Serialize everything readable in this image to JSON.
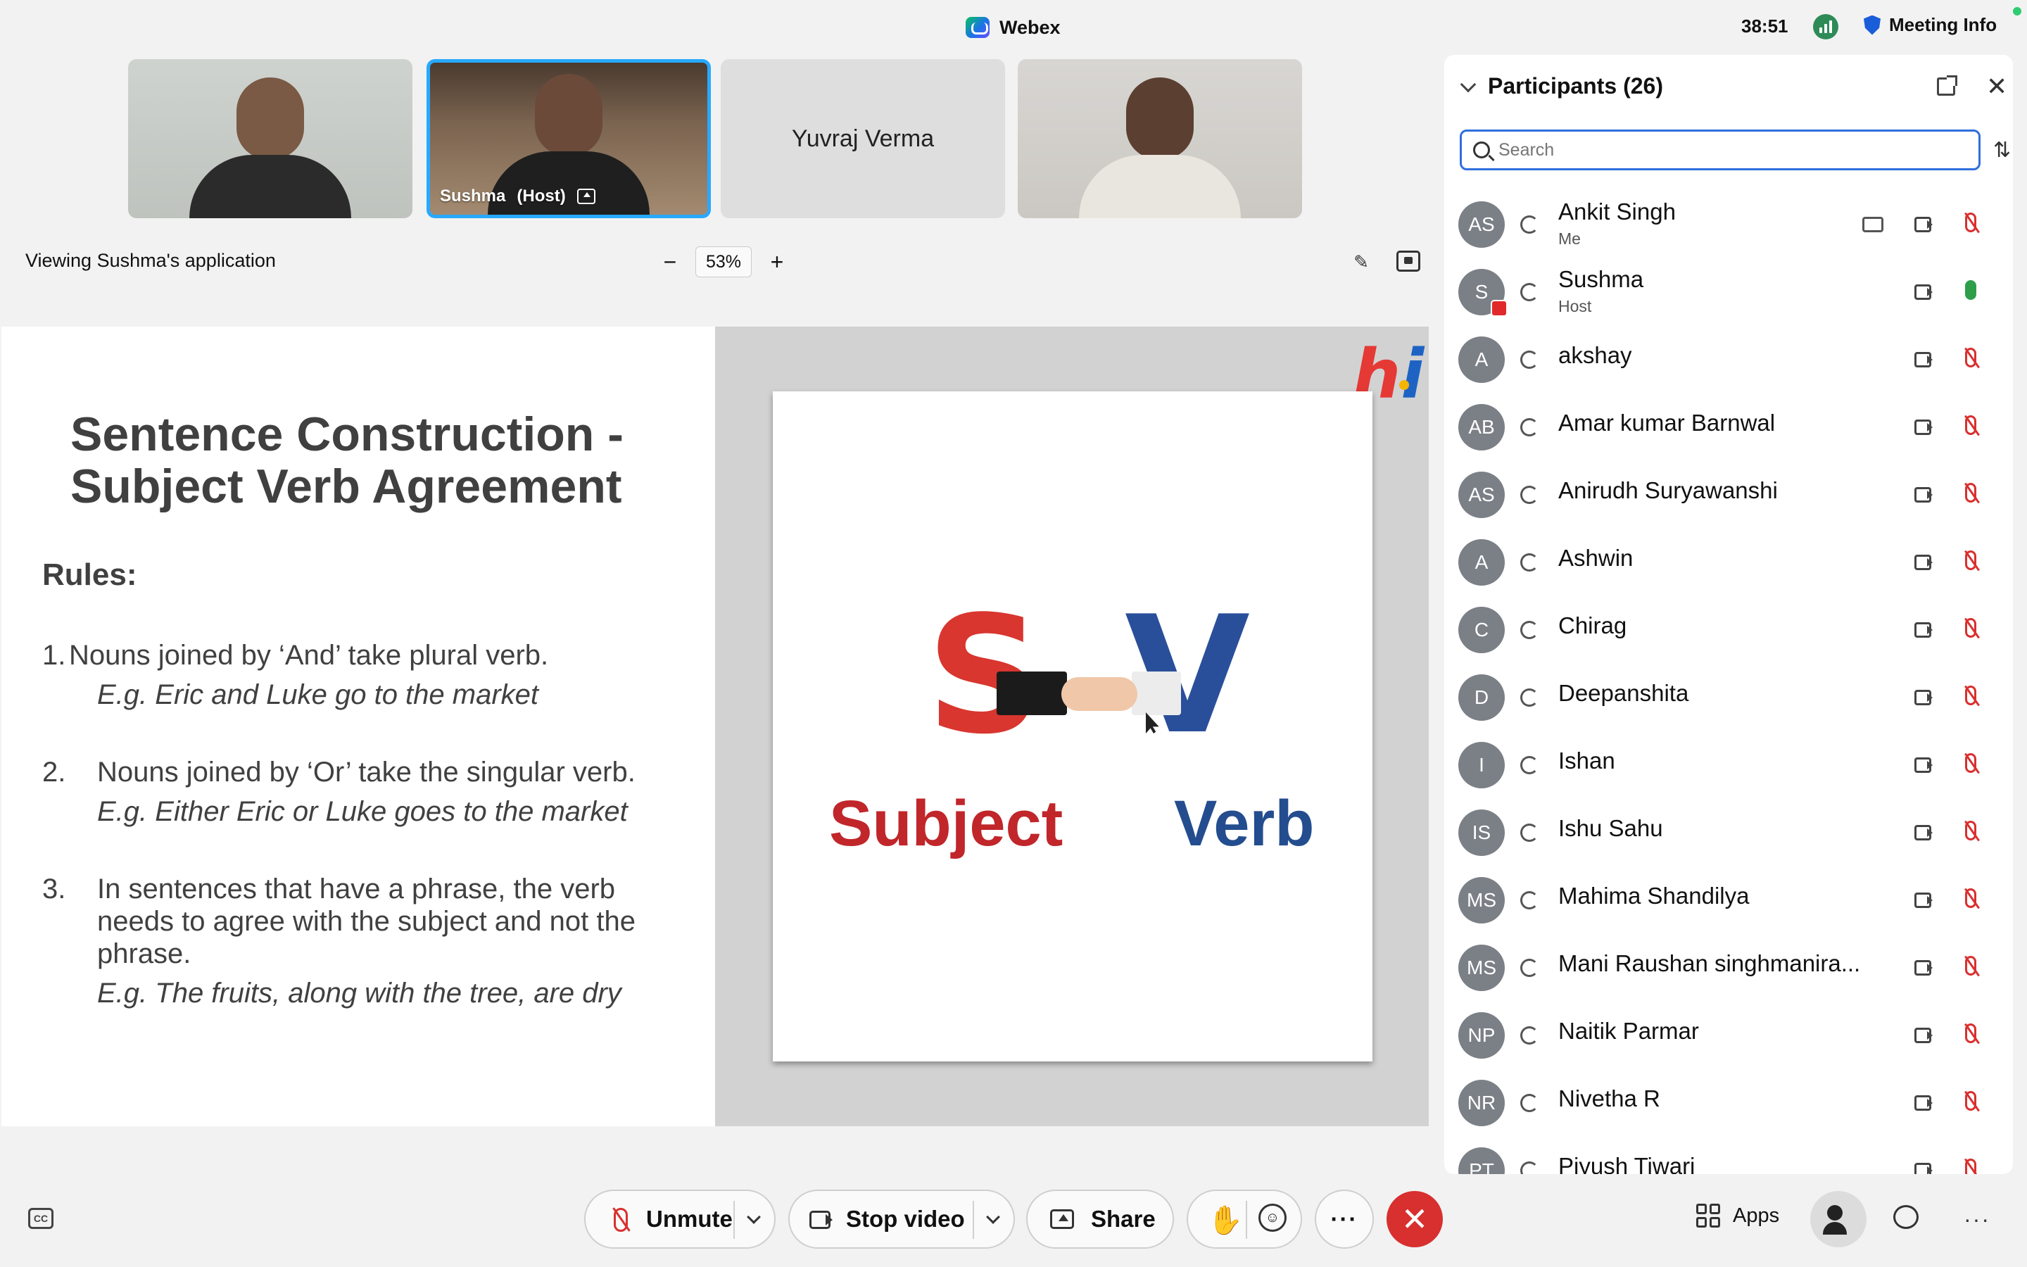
{
  "app": {
    "title": "Webex",
    "timer": "38:51",
    "meeting_info": "Meeting Info"
  },
  "videos": {
    "tile2_name": "Sushma",
    "tile2_role": "(Host)",
    "tile3_name": "Yuvraj Verma"
  },
  "share": {
    "viewing_label": "Viewing Sushma's application",
    "zoom_minus": "−",
    "zoom_value": "53%",
    "zoom_plus": "+"
  },
  "slide": {
    "title": "Sentence Construction - Subject Verb Agreement",
    "rules_heading": "Rules:",
    "rules": [
      {
        "num": "1.",
        "text": "Nouns joined by ‘And’ take plural verb.",
        "example": "E.g.  Eric and Luke go to the market"
      },
      {
        "num": "2.",
        "text": "Nouns joined by ‘Or’ take the singular verb.",
        "example": "E.g.  Either Eric or Luke goes to the market"
      },
      {
        "num": "3.",
        "text": "In sentences that have a phrase, the verb needs to agree with the subject and not the phrase.",
        "example": "E.g. The fruits, along with the tree, are dry"
      }
    ],
    "logo_h": "h",
    "logo_i": "i",
    "big_s": "S",
    "big_v": "V",
    "word_subject": "Subject",
    "word_verb": "Verb"
  },
  "panel": {
    "title": "Participants (26)",
    "search_placeholder": "Search",
    "participants": [
      {
        "initials": "AS",
        "name": "Ankit Singh",
        "role": "Me",
        "mic": "muted",
        "cc": true
      },
      {
        "initials": "S",
        "name": "Sushma",
        "role": "Host",
        "mic": "on",
        "badge": true
      },
      {
        "initials": "A",
        "name": "akshay",
        "mic": "muted"
      },
      {
        "initials": "AB",
        "name": "Amar kumar Barnwal",
        "mic": "muted"
      },
      {
        "initials": "AS",
        "name": "Anirudh Suryawanshi",
        "mic": "muted"
      },
      {
        "initials": "A",
        "name": "Ashwin",
        "mic": "muted"
      },
      {
        "initials": "C",
        "name": "Chirag",
        "mic": "muted"
      },
      {
        "initials": "D",
        "name": "Deepanshita",
        "mic": "muted"
      },
      {
        "initials": "I",
        "name": "Ishan",
        "mic": "muted"
      },
      {
        "initials": "IS",
        "name": "Ishu Sahu",
        "mic": "muted"
      },
      {
        "initials": "MS",
        "name": "Mahima Shandilya",
        "mic": "muted"
      },
      {
        "initials": "MS",
        "name": "Mani Raushan singhmanira...",
        "mic": "muted"
      },
      {
        "initials": "NP",
        "name": "Naitik Parmar",
        "mic": "muted"
      },
      {
        "initials": "NR",
        "name": "Nivetha R",
        "mic": "muted"
      },
      {
        "initials": "PT",
        "name": "Piyush Tiwari",
        "mic": "muted"
      }
    ]
  },
  "toolbar": {
    "cc_label": "CC",
    "unmute": "Unmute",
    "stop_video": "Stop video",
    "share": "Share",
    "more": "···",
    "leave": "✕",
    "apps": "Apps",
    "overflow": "···"
  }
}
